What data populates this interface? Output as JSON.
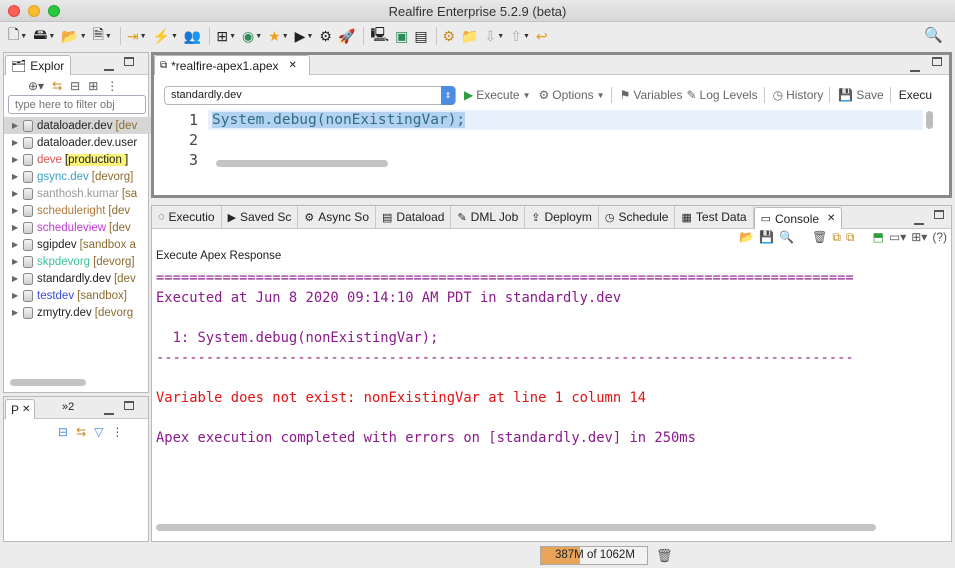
{
  "window": {
    "title": "Realfire Enterprise 5.2.9 (beta)"
  },
  "explorer": {
    "tab_label": "Explor",
    "filter_placeholder": "type here to filter obj",
    "items": [
      {
        "name": "dataloader.dev",
        "tag": "[dev",
        "name_color": "#222",
        "selected": true
      },
      {
        "name": "dataloader.dev.user",
        "tag": "",
        "name_color": "#222"
      },
      {
        "name": "deve",
        "tag": "[production ]",
        "name_color": "#d9534f",
        "highlight": true
      },
      {
        "name": "gsync.dev",
        "tag": "[devorg]",
        "name_color": "#3aa0c8"
      },
      {
        "name": "santhosh.kumar",
        "tag": "[sa",
        "name_color": "#999"
      },
      {
        "name": "scheduleright",
        "tag": "[dev",
        "name_color": "#b07a3a"
      },
      {
        "name": "scheduleview",
        "tag": "[dev",
        "name_color": "#c23ad8"
      },
      {
        "name": "sgipdev",
        "tag": "[sandbox a",
        "name_color": "#222"
      },
      {
        "name": "skpdevorg",
        "tag": "[devorg]",
        "name_color": "#3bbfa0"
      },
      {
        "name": "standardly.dev",
        "tag": "[dev",
        "name_color": "#222"
      },
      {
        "name": "testdev",
        "tag": "[sandbox]",
        "name_color": "#3a4ad8"
      },
      {
        "name": "zmytry.dev",
        "tag": "[devorg",
        "name_color": "#222"
      }
    ]
  },
  "lower_left": {
    "tab_label": "P",
    "overflow_label": "»2"
  },
  "editor": {
    "tab_label": "*realfire-apex1.apex",
    "org": "standardly.dev",
    "buttons": {
      "execute": "Execute",
      "options": "Options",
      "variables": "Variables",
      "log_levels": "Log Levels",
      "history": "History",
      "save": "Save",
      "exec_trunc": "Execu"
    },
    "line_numbers": [
      "1",
      "2",
      "3"
    ],
    "code_line1": "System.debug(nonExistingVar);"
  },
  "bottom_tabs": [
    {
      "label": "Executio",
      "icon": "execution-icon"
    },
    {
      "label": "Saved Sc",
      "icon": "saved-scripts-icon"
    },
    {
      "label": "Async So",
      "icon": "async-icon"
    },
    {
      "label": "Dataload",
      "icon": "dataload-icon"
    },
    {
      "label": "DML Job",
      "icon": "dml-icon"
    },
    {
      "label": "Deploym",
      "icon": "deploy-icon"
    },
    {
      "label": "Schedule",
      "icon": "schedule-icon"
    },
    {
      "label": "Test Data",
      "icon": "test-data-icon"
    },
    {
      "label": "Console",
      "icon": "console-icon",
      "active": true
    }
  ],
  "console": {
    "title": "Execute Apex Response",
    "separator_double": "====================================================================================",
    "executed_line": "Executed at Jun 8 2020 09:14:10 AM PDT in standardly.dev",
    "source_line": "  1: System.debug(nonExistingVar);",
    "separator_single": "------------------------------------------------------------------------------------",
    "error_line": "Variable does not exist: nonExistingVar at line 1 column 14",
    "completed_line": "Apex execution completed with errors on [standardly.dev] in 250ms",
    "help_label": "(?)"
  },
  "status": {
    "heap": "387M of 1062M",
    "heap_fraction": 0.364
  }
}
